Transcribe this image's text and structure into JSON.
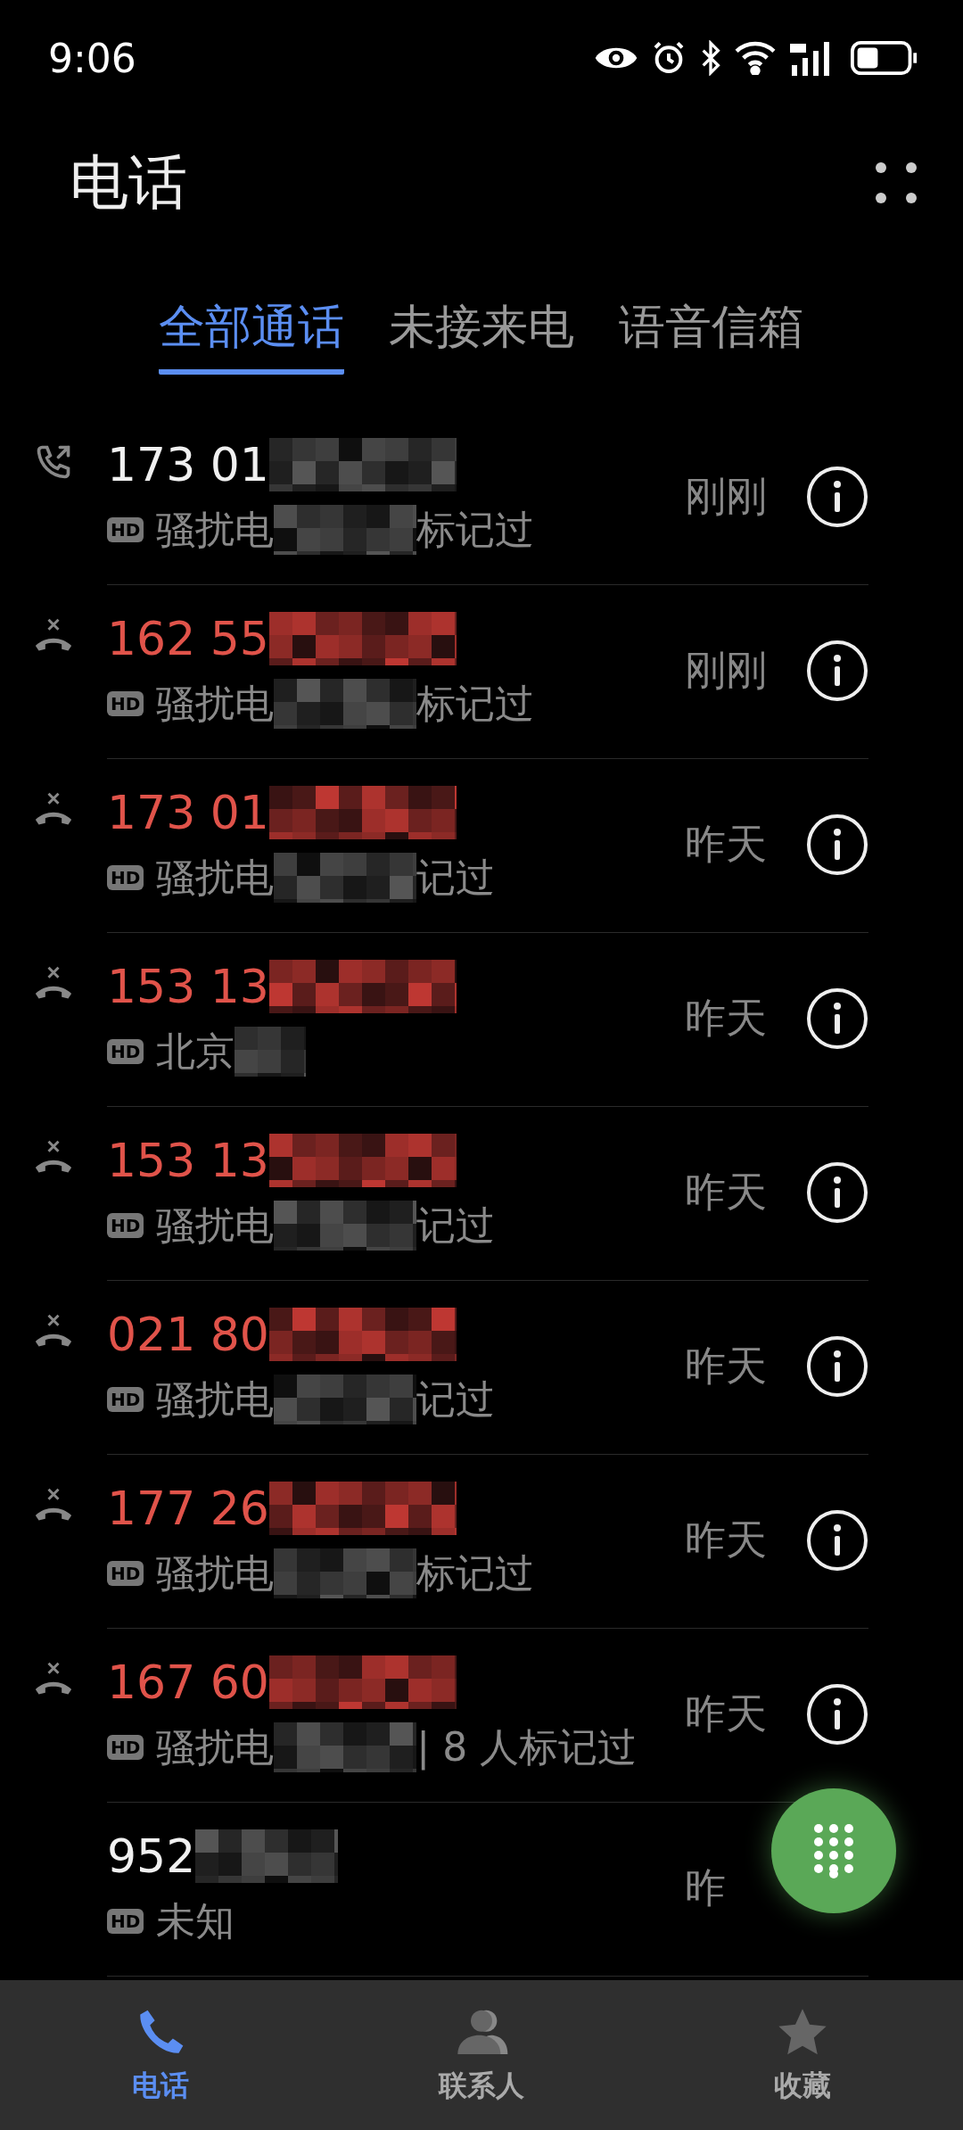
{
  "status_bar": {
    "time": "9:06"
  },
  "header": {
    "title": "电话"
  },
  "tabs": [
    {
      "label": "全部通话",
      "selected": true
    },
    {
      "label": "未接来电",
      "selected": false
    },
    {
      "label": "语音信箱",
      "selected": false
    }
  ],
  "calls": [
    {
      "kind": "outgoing",
      "missed": false,
      "number": "173 01",
      "badge": "HD",
      "subtitle_start": "骚扰电",
      "subtitle_end": "标记过",
      "time": "刚刚"
    },
    {
      "kind": "missed",
      "missed": true,
      "number": "162 55",
      "badge": "HD",
      "subtitle_start": "骚扰电",
      "subtitle_end": "标记过",
      "time": "刚刚"
    },
    {
      "kind": "missed",
      "missed": true,
      "number": "173 01",
      "badge": "HD",
      "subtitle_start": "骚扰电",
      "subtitle_end": "记过",
      "time": "昨天"
    },
    {
      "kind": "missed",
      "missed": true,
      "number": "153 13",
      "badge": "HD",
      "subtitle_start": "北京",
      "time": "昨天"
    },
    {
      "kind": "missed",
      "missed": true,
      "number": "153 13",
      "badge": "HD",
      "subtitle_start": "骚扰电",
      "subtitle_end": "记过",
      "time": "昨天"
    },
    {
      "kind": "missed",
      "missed": true,
      "number": "021 80",
      "badge": "HD",
      "subtitle_start": "骚扰电",
      "subtitle_end": "记过",
      "time": "昨天"
    },
    {
      "kind": "missed",
      "missed": true,
      "number": "177 26",
      "badge": "HD",
      "subtitle_start": "骚扰电",
      "subtitle_end": "标记过",
      "time": "昨天"
    },
    {
      "kind": "missed",
      "missed": true,
      "number": "167 60",
      "badge": "HD",
      "subtitle_start": "骚扰电",
      "subtitle_end": "| 8 人标记过",
      "time": "昨天"
    },
    {
      "kind": "none",
      "missed": false,
      "number": "952",
      "badge": "HD",
      "subtitle_start": "未知",
      "time": "昨"
    }
  ],
  "bottom_nav": [
    {
      "label": "电话",
      "selected": true
    },
    {
      "label": "联系人",
      "selected": false
    },
    {
      "label": "收藏",
      "selected": false
    }
  ]
}
